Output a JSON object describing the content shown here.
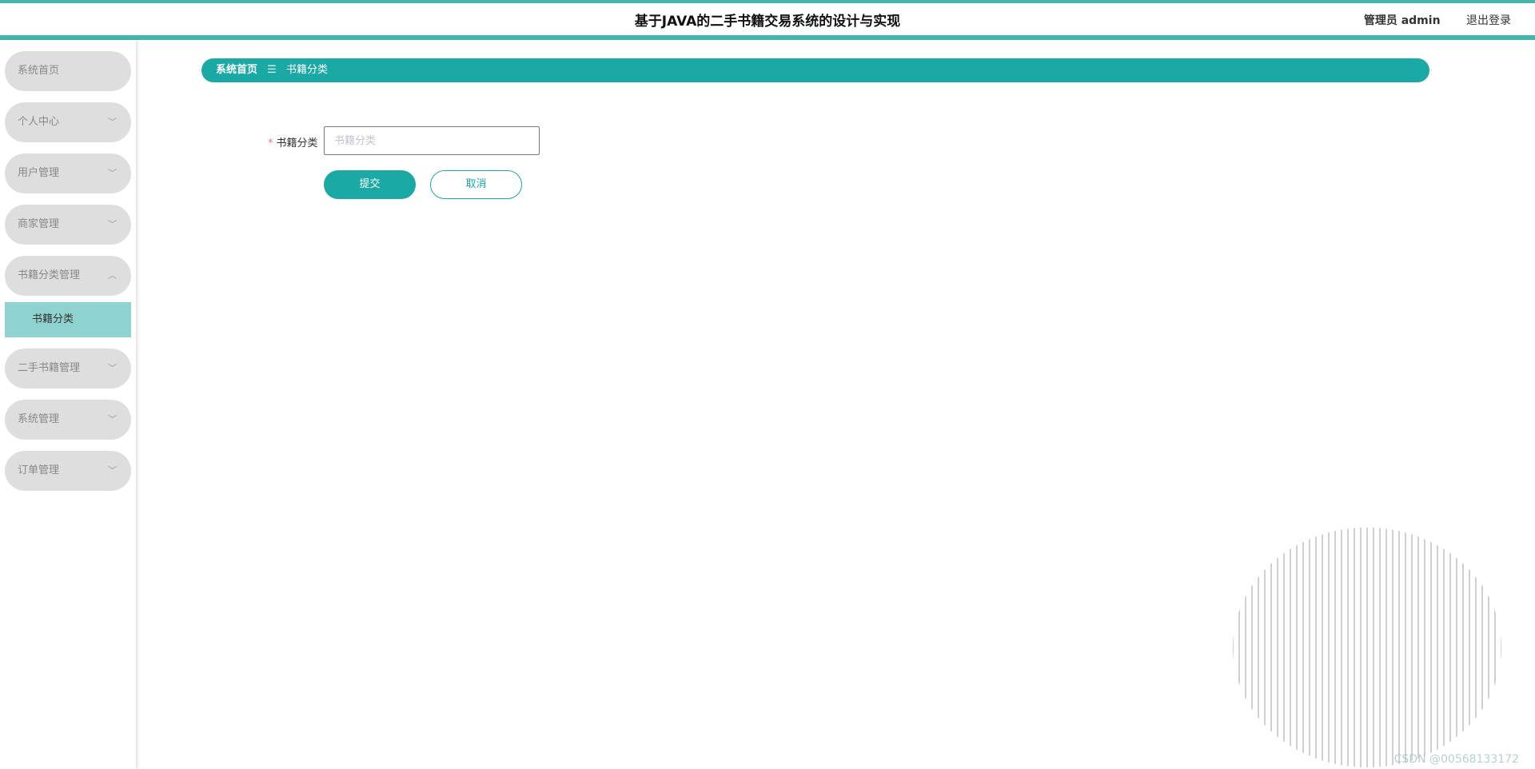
{
  "header": {
    "title": "基于JAVA的二手书籍交易系统的设计与实现",
    "user_role": "管理员 admin",
    "logout_label": "退出登录"
  },
  "sidebar": {
    "items": [
      {
        "label": "系统首页",
        "chevron": ""
      },
      {
        "label": "个人中心",
        "chevron": "chevron-down"
      },
      {
        "label": "用户管理",
        "chevron": "chevron-down"
      },
      {
        "label": "商家管理",
        "chevron": "chevron-down"
      },
      {
        "label": "书籍分类管理",
        "chevron": "chevron-up"
      },
      {
        "label": "二手书籍管理",
        "chevron": "chevron-down"
      },
      {
        "label": "系统管理",
        "chevron": "chevron-down"
      },
      {
        "label": "订单管理",
        "chevron": "chevron-down"
      }
    ],
    "sub_items": [
      {
        "label": "书籍分类",
        "active": true
      }
    ]
  },
  "breadcrumb": {
    "home": "系统首页",
    "separator_icon": "menu-icon",
    "current": "书籍分类"
  },
  "form": {
    "field_label": "书籍分类",
    "required_mark": "*",
    "field_placeholder": "书籍分类",
    "field_value": "",
    "submit_label": "提交",
    "cancel_label": "取消"
  },
  "watermark": "CSDN @00568133172",
  "colors": {
    "accent": "#1aa9a4",
    "header_border": "#45b5ac",
    "menu_bg": "#dedede",
    "submenu_active": "#8fd3d1"
  }
}
